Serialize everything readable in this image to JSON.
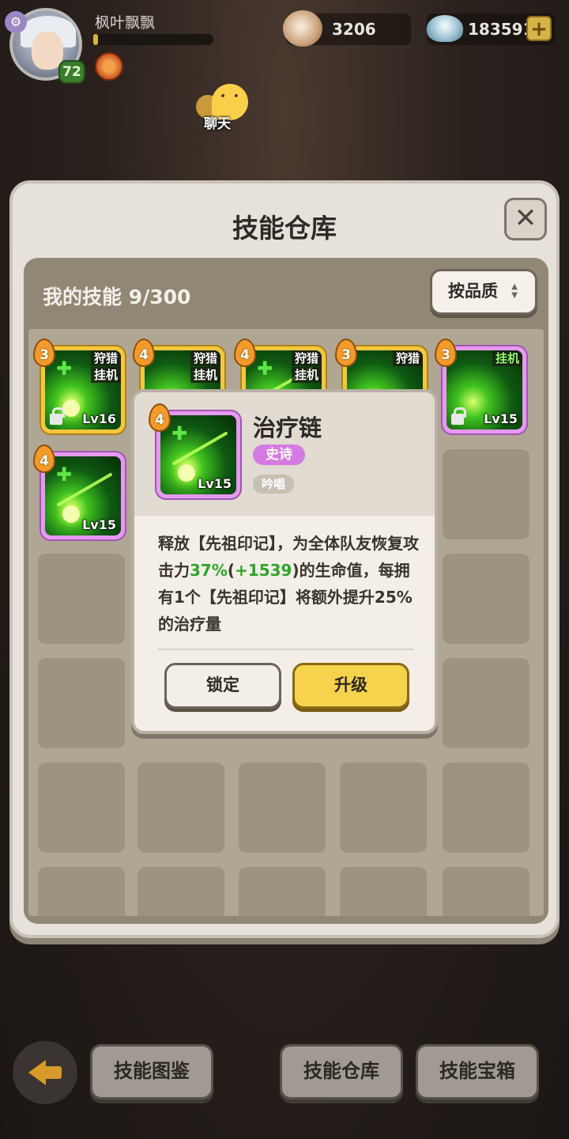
{
  "player": {
    "name": "枫叶飘飘",
    "level": "72",
    "xp_progress": 0.04
  },
  "currency": {
    "shells": "3206",
    "gems": "183591"
  },
  "chat": {
    "label": "聊天"
  },
  "panel": {
    "title": "技能仓库",
    "skill_count": "我的技能 9/300",
    "sort_label": "按品质"
  },
  "skills": [
    {
      "stars": "3",
      "tag1": "狩猎",
      "tag2": "挂机",
      "level": "Lv16",
      "locked": true,
      "rarity": "gold"
    },
    {
      "stars": "4",
      "tag1": "狩猎",
      "tag2": "挂机",
      "level": "",
      "locked": false,
      "rarity": "gold"
    },
    {
      "stars": "4",
      "tag1": "狩猎",
      "tag2": "挂机",
      "level": "",
      "locked": false,
      "rarity": "gold"
    },
    {
      "stars": "3",
      "tag1": "狩猎",
      "tag2": "",
      "level": "",
      "locked": false,
      "rarity": "gold"
    },
    {
      "stars": "3",
      "tag1": "挂机",
      "tag2": "",
      "level": "Lv15",
      "locked": true,
      "rarity": "purple"
    },
    {
      "stars": "4",
      "tag1": "",
      "tag2": "",
      "level": "Lv15",
      "locked": false,
      "rarity": "purple"
    }
  ],
  "popup": {
    "stars": "4",
    "level": "Lv15",
    "name": "治疗链",
    "rarity": "史诗",
    "type": "吟唱",
    "desc_part1": "释放【先祖印记】，为全体队友恢复攻击力",
    "desc_percent": "37%",
    "desc_paren_open": "(",
    "desc_bonus": "+1539",
    "desc_paren_close": ")",
    "desc_part2": "的生命值，每拥有1个【先祖印记】将额外提升25%的治疗量",
    "lock_label": "锁定",
    "upgrade_label": "升级"
  },
  "bottom": {
    "codex_label": "技能图鉴",
    "warehouse_label": "技能仓库",
    "chest_label": "技能宝箱"
  },
  "colors": {
    "gold_frame": "#f5c73e",
    "epic_purple": "#e59af0",
    "highlight_green": "#2ea52a",
    "upgrade_yellow": "#f7d24d"
  }
}
